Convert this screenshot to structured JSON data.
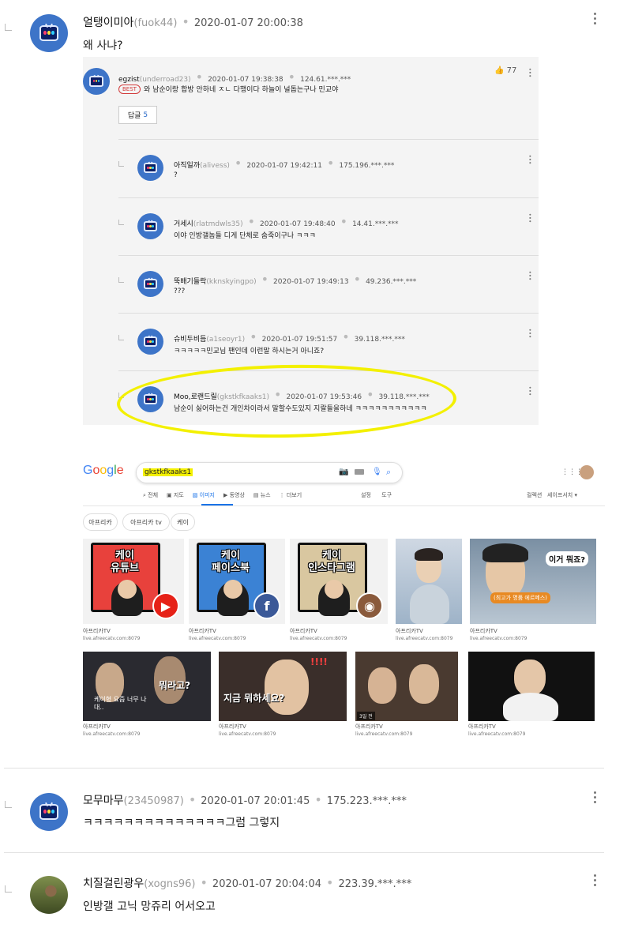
{
  "top_comment": {
    "name": "얼탱이미아",
    "nick": "(fuok44)",
    "time": "2020-01-07 20:00:38",
    "text": "왜 사냐?"
  },
  "screenshot_panel": {
    "main_reply": {
      "name": "egzist",
      "nick": "(underroad23)",
      "time": "2020-01-07 19:38:38",
      "ip": "124.61.***.***",
      "like_count": "77",
      "best_badge": "BEST",
      "text": "와 남순이랑 합방 안하네 ㅈㄴ 다행이다 하늘이 널돕는구나 민교야",
      "reply_button": "답글",
      "reply_count": "5"
    },
    "replies": [
      {
        "name": "아직일까",
        "nick": "(alivess)",
        "time": "2020-01-07 19:42:11",
        "ip": "175.196.***.***",
        "text": "?"
      },
      {
        "name": "거세시",
        "nick": "(rlatmdwls35)",
        "time": "2020-01-07 19:48:40",
        "ip": "14.41.***.***",
        "text": "이야 인방갤놈들 디게 단체로 숨죽이구나 ㅋㅋㅋ"
      },
      {
        "name": "뚝배기들락",
        "nick": "(kknskyingpo)",
        "time": "2020-01-07 19:49:13",
        "ip": "49.236.***.***",
        "text": "???"
      },
      {
        "name": "슈비두비듬",
        "nick": "(a1seoyr1)",
        "time": "2020-01-07 19:51:57",
        "ip": "39.118.***.***",
        "text": "ㅋㅋㅋㅋㅋ민교님 팬인데 이런말 하시는거 아니죠?"
      },
      {
        "name": "Moo,로랜드릴",
        "nick": "(gkstkfkaaks1)",
        "time": "2020-01-07 19:53:46",
        "ip": "39.118.***.***",
        "text": "남순이 싫어하는건 개인차이라서 말할수도있지 지랄들을하네 ㅋㅋㅋㅋㅋㅋㅋㅋㅋㅋㅋ"
      }
    ]
  },
  "google": {
    "logo_letters": [
      "G",
      "o",
      "o",
      "g",
      "l",
      "e"
    ],
    "logo_colors": [
      "#4285f4",
      "#ea4335",
      "#fbbc05",
      "#4285f4",
      "#34a853",
      "#ea4335"
    ],
    "query": "gkstkfkaaks1",
    "tabs": [
      "전체",
      "지도",
      "이미지",
      "동영상",
      "뉴스",
      "더보기"
    ],
    "active_tab": "이미지",
    "tools": [
      "설정",
      "도구"
    ],
    "right_tools": [
      "컬렉션",
      "세이프서치"
    ],
    "chips": [
      "아프리카",
      "아프리카 tv",
      "케이"
    ],
    "row1": [
      {
        "caption": "케이\n유튜브",
        "color": "#e8413c",
        "badge": "▶",
        "badge_color": "#e62117",
        "source": "아프리카TV",
        "site": "live.afreecatv.com:8079"
      },
      {
        "caption": "케이\n페이스북",
        "color": "#3b82d4",
        "badge": "f",
        "badge_color": "#3b5998",
        "source": "아프리카TV",
        "site": "live.afreecatv.com:8079"
      },
      {
        "caption": "케이\n인스타그램",
        "color": "#d9c7a0",
        "badge": "◉",
        "badge_color": "#8a5a3c",
        "source": "아프리카TV",
        "site": "live.afreecatv.com:8079"
      },
      {
        "caption": "",
        "source": "아프리카TV",
        "site": "live.afreecatv.com:8079"
      },
      {
        "caption": "이거 뭐죠?",
        "sub": "(최고가 명품 에르메스)",
        "source": "아프리카TV",
        "site": "live.afreecatv.com:8079"
      }
    ],
    "row2": [
      {
        "caption": "뭐라고?",
        "sub": "케이형 요즘 너무 나대..",
        "source": "아프리카TV",
        "site": "live.afreecatv.com:8079"
      },
      {
        "caption": "지금 뭐하세요?",
        "sub": "!!!!",
        "source": "아프리카TV",
        "site": "live.afreecatv.com:8079"
      },
      {
        "caption": "",
        "sub": "3일 전",
        "source": "아프리카TV",
        "site": "live.afreecatv.com:8079"
      },
      {
        "caption": "",
        "source": "아프리카TV",
        "site": "live.afreecatv.com:8079"
      }
    ]
  },
  "comments": [
    {
      "name": "모무마무",
      "nick": "(23450987)",
      "time": "2020-01-07 20:01:45",
      "ip": "175.223.***.***",
      "text": "ㅋㅋㅋㅋㅋㅋㅋㅋㅋㅋㅋㅋㅋㅋ그럼 그렇지"
    },
    {
      "name": "치질걸린광우",
      "nick": "(xogns96)",
      "time": "2020-01-07 20:04:04",
      "ip": "223.39.***.***",
      "text": "인방갤 고닉 망쥬리 어서오고"
    }
  ],
  "colors": {
    "highlight": "#f3f000",
    "avatar_blue": "#3d74c8",
    "best_red": "#d23b3b",
    "link_blue": "#2a6ac8"
  }
}
